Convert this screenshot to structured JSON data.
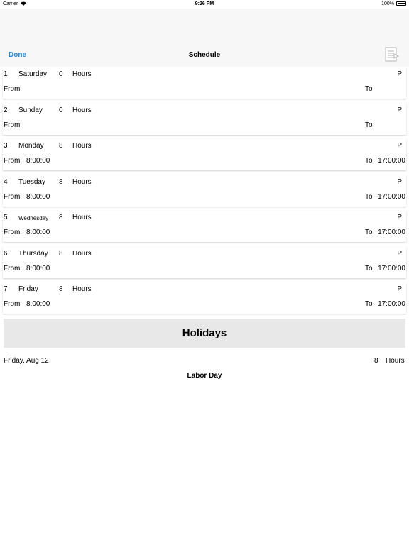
{
  "status_bar": {
    "carrier": "Carrier",
    "time": "9:26 PM",
    "battery": "100%"
  },
  "nav": {
    "done_label": "Done",
    "title": "Schedule",
    "right_icon": "document-list-icon"
  },
  "days": [
    {
      "num": "1",
      "name": "Saturday",
      "hours": "0",
      "hours_label": "Hours",
      "p": "P",
      "from_label": "From",
      "from": "",
      "to_label": "To",
      "to": ""
    },
    {
      "num": "2",
      "name": "Sunday",
      "hours": "0",
      "hours_label": "Hours",
      "p": "P",
      "from_label": "From",
      "from": "",
      "to_label": "To",
      "to": ""
    },
    {
      "num": "3",
      "name": "Monday",
      "hours": "8",
      "hours_label": "Hours",
      "p": "P",
      "from_label": "From",
      "from": "8:00:00",
      "to_label": "To",
      "to": "17:00:00"
    },
    {
      "num": "4",
      "name": "Tuesday",
      "hours": "8",
      "hours_label": "Hours",
      "p": "P",
      "from_label": "From",
      "from": "8:00:00",
      "to_label": "To",
      "to": "17:00:00"
    },
    {
      "num": "5",
      "name": "Wednesday",
      "hours": "8",
      "hours_label": "Hours",
      "p": "P",
      "from_label": "From",
      "from": "8:00:00",
      "to_label": "To",
      "to": "17:00:00"
    },
    {
      "num": "6",
      "name": "Thursday",
      "hours": "8",
      "hours_label": "Hours",
      "p": "P",
      "from_label": "From",
      "from": "8:00:00",
      "to_label": "To",
      "to": "17:00:00"
    },
    {
      "num": "7",
      "name": "Friday",
      "hours": "8",
      "hours_label": "Hours",
      "p": "P",
      "from_label": "From",
      "from": "8:00:00",
      "to_label": "To",
      "to": "17:00:00"
    }
  ],
  "holidays": {
    "title": "Holidays",
    "items": [
      {
        "date": "Friday, Aug 12",
        "hours": "8",
        "hours_label": "Hours",
        "name": "Labor Day"
      }
    ]
  },
  "colors": {
    "accent": "#1e88e5",
    "nav_background": "#f7f7f7",
    "banner_background": "#e8e8e8"
  }
}
